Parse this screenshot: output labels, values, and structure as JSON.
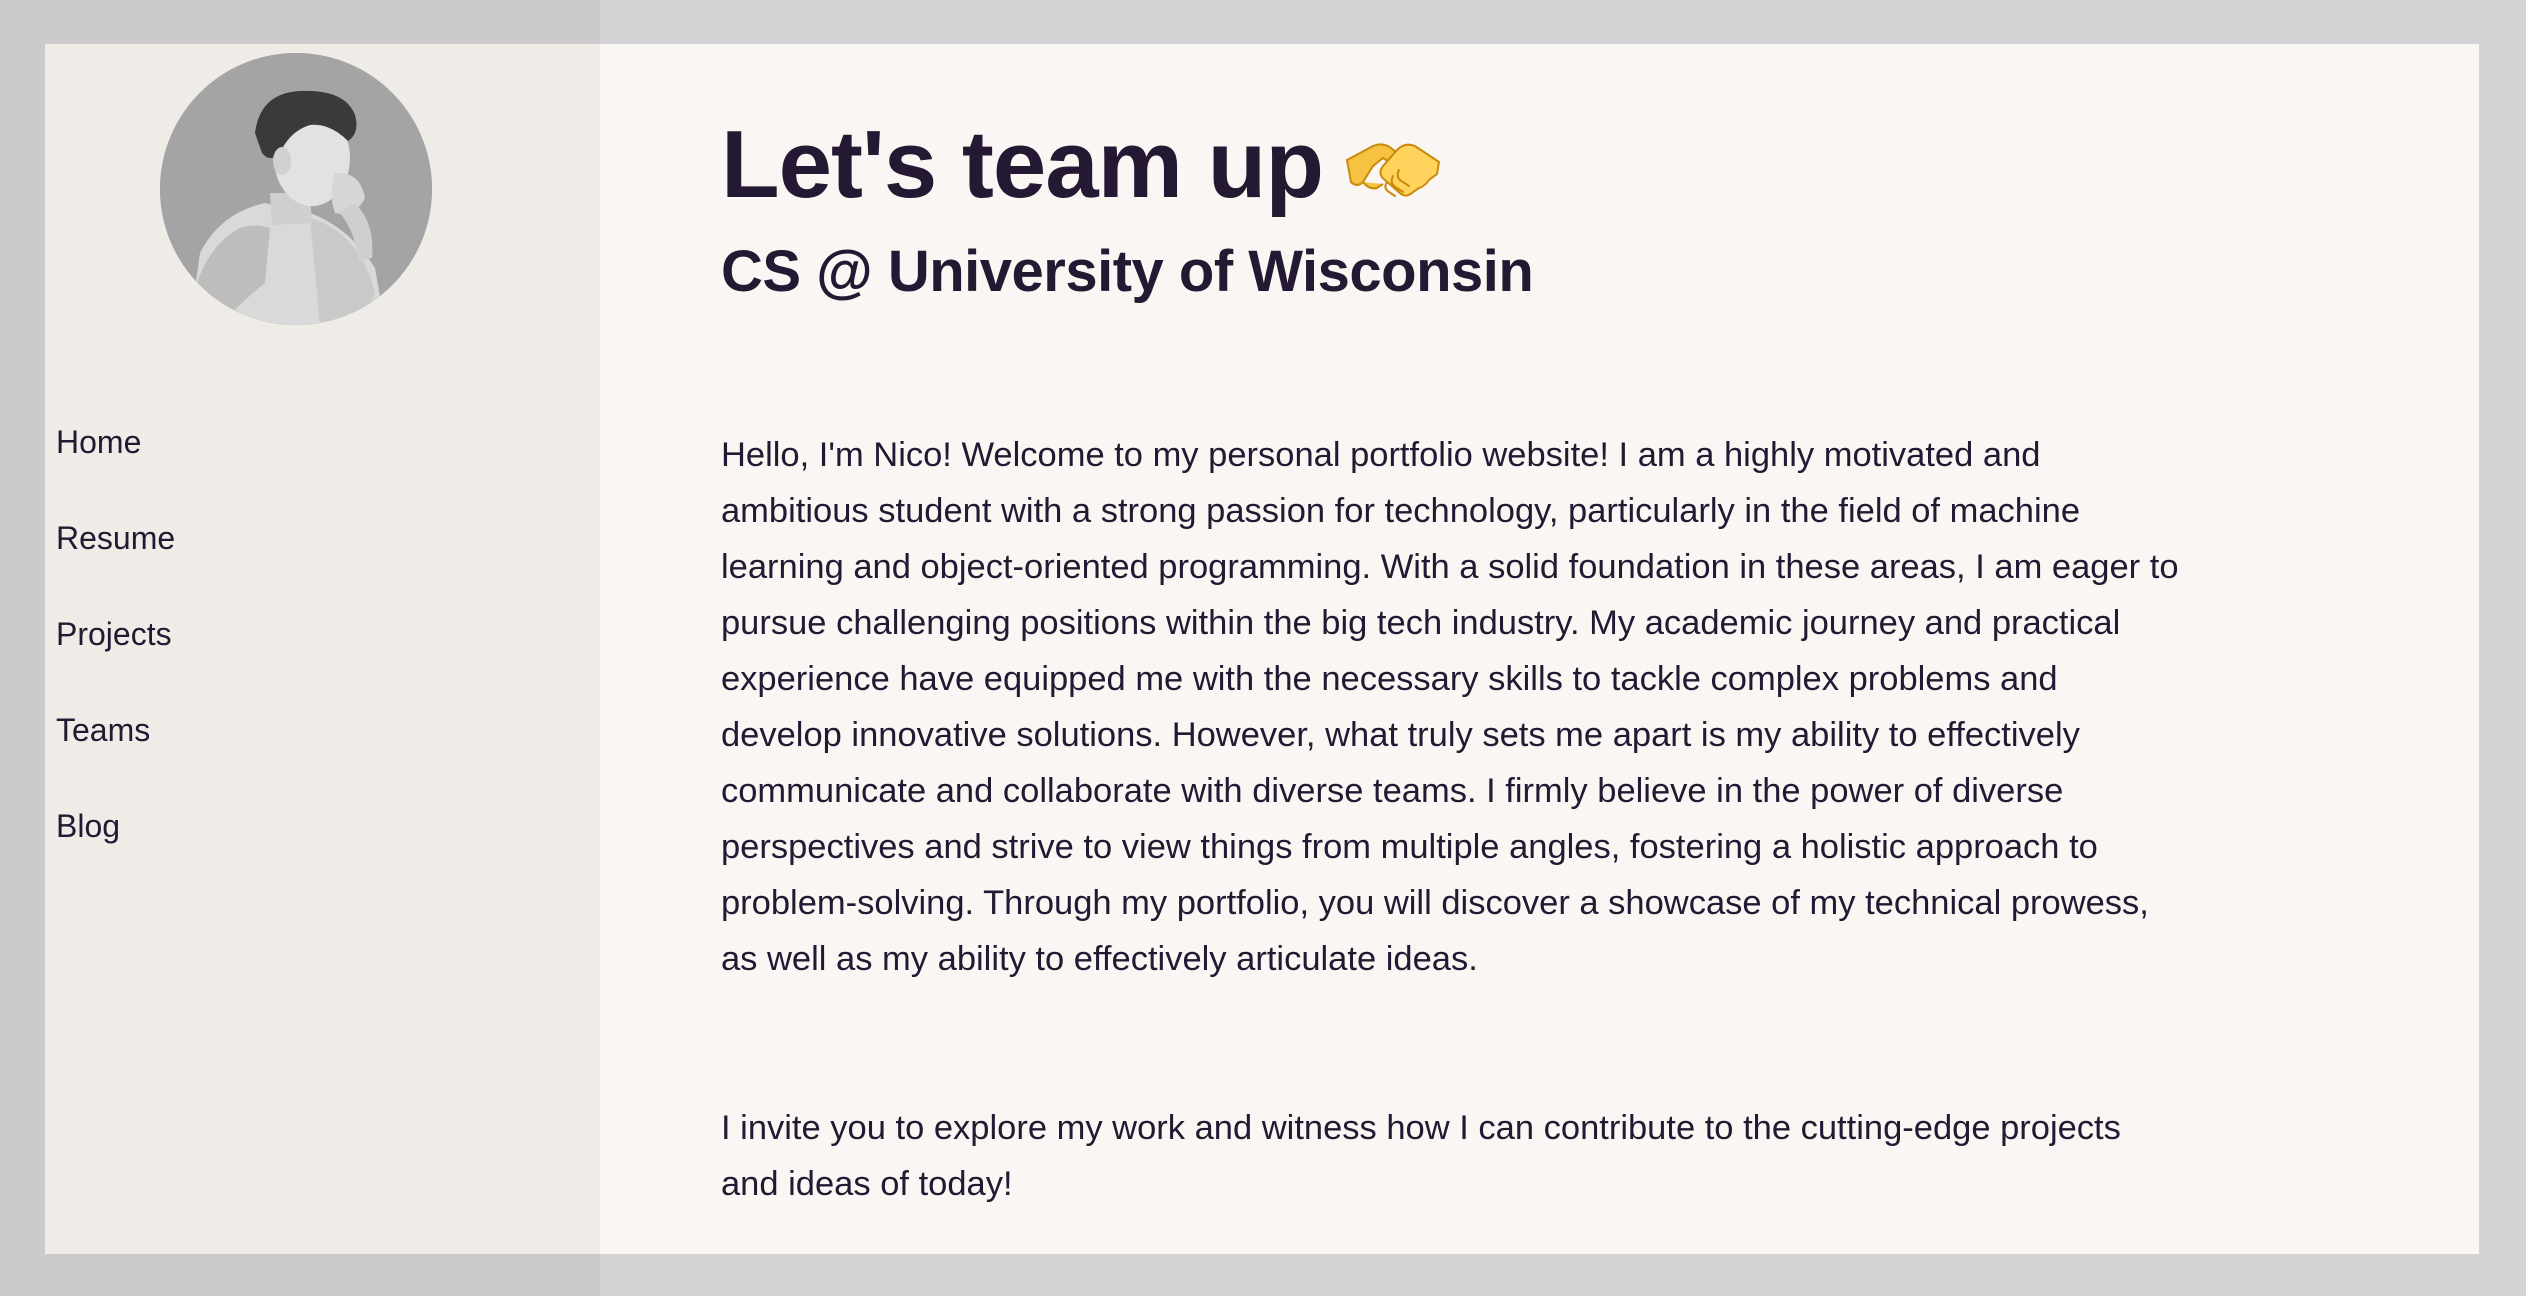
{
  "sidebar": {
    "avatar_alt": "Profile photo of Nico",
    "nav": [
      {
        "label": "Home"
      },
      {
        "label": "Resume"
      },
      {
        "label": "Projects"
      },
      {
        "label": "Teams"
      },
      {
        "label": "Blog"
      }
    ]
  },
  "main": {
    "title": "Let's team up",
    "title_icon": "handshake-icon",
    "subtitle": "CS @ University of Wisconsin",
    "intro": "Hello, I'm Nico! Welcome to my personal portfolio website! I am a highly motivated and ambitious student with a strong passion for technology, particularly in the field of machine learning and object-oriented programming. With a solid foundation in these areas, I am eager to pursue challenging positions within the big tech industry. My academic journey and practical experience have equipped me with the necessary skills to tackle complex problems and develop innovative solutions. However, what truly sets me apart is my ability to effectively communicate and collaborate with diverse teams. I firmly believe in the power of diverse perspectives and strive to view things from multiple angles, fostering a holistic approach to problem-solving. Through my portfolio, you will discover a showcase of my technical prowess, as well as my ability to effectively articulate ideas.",
    "invite": "I invite you to explore my work and witness how I can contribute to the cutting-edge projects and ideas of today!"
  },
  "colors": {
    "background": "#d4d3d5",
    "content_bg": "#f9f6f3",
    "sidebar_bg": "#efebe7",
    "text": "#241833"
  }
}
